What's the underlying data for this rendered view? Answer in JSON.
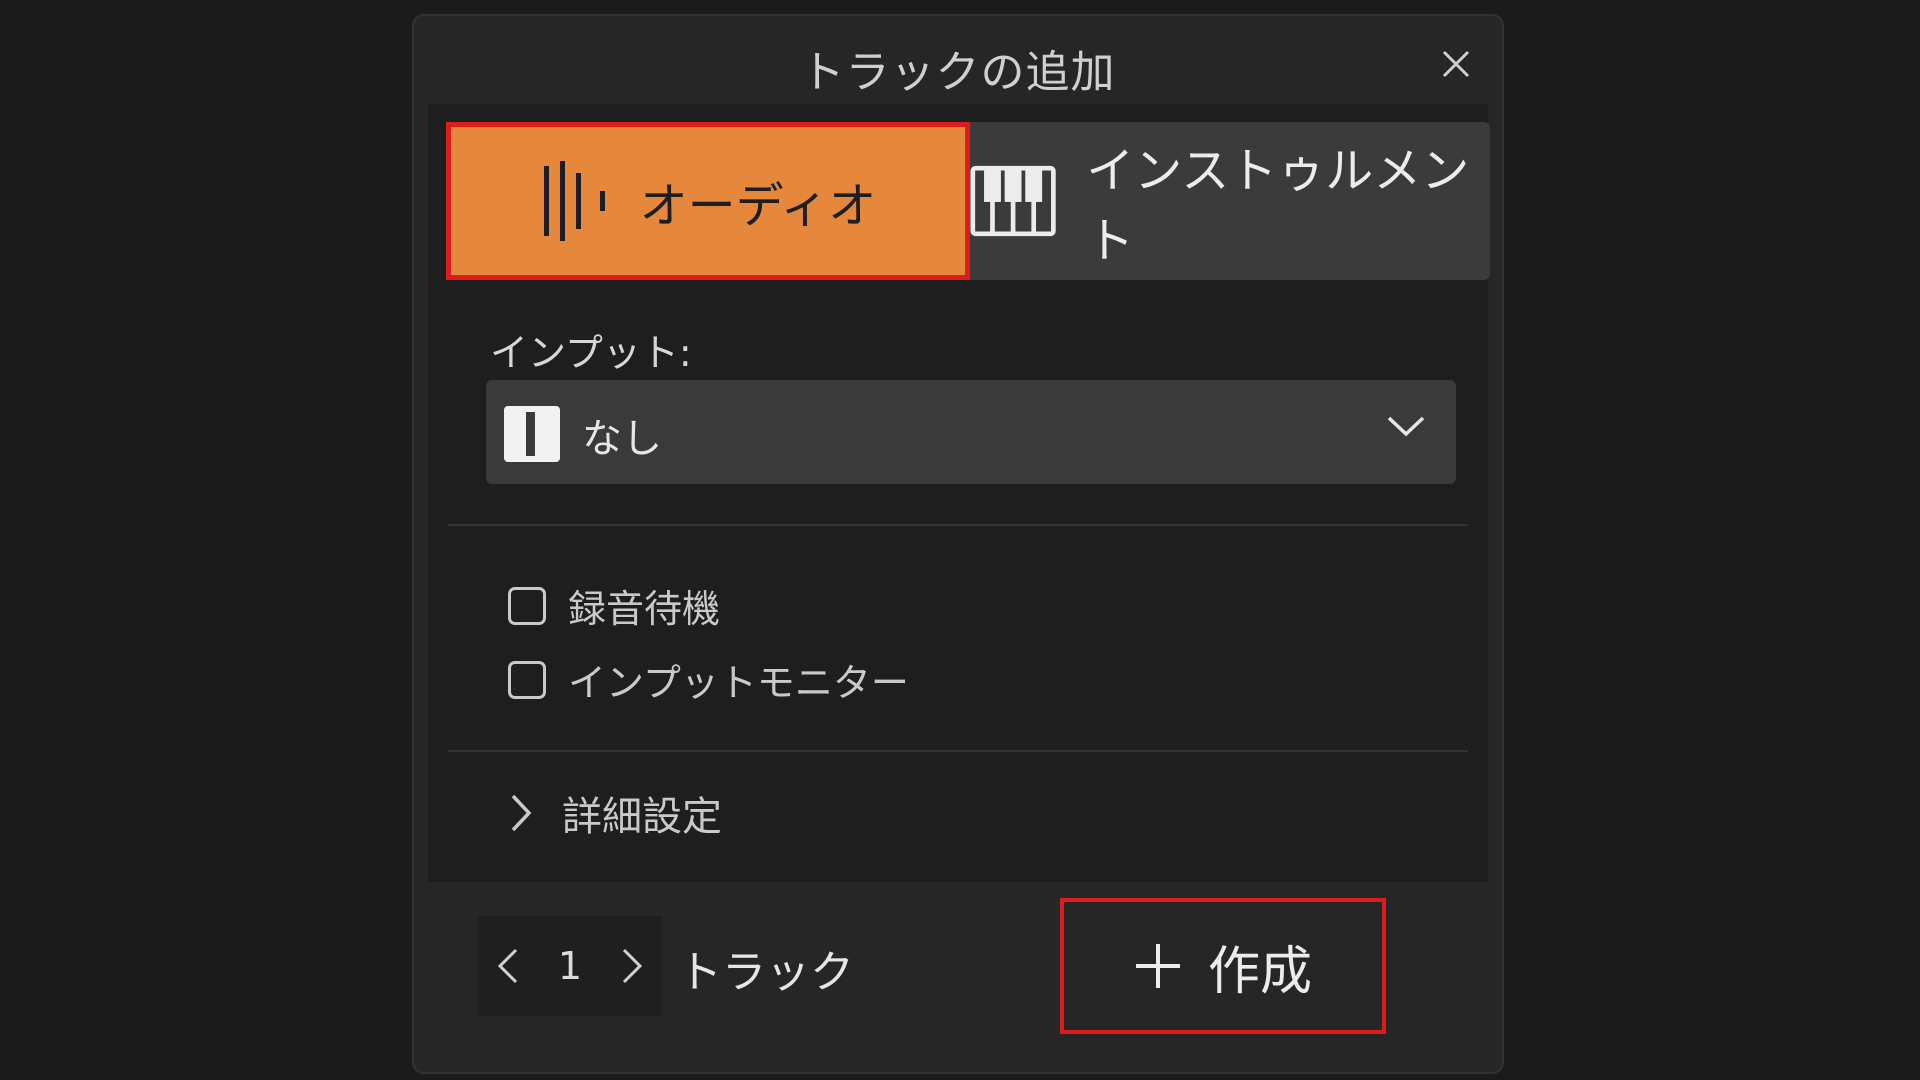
{
  "dialog": {
    "title": "トラックの追加",
    "close_icon": "close-icon"
  },
  "track_type": {
    "audio_label": "オーディオ",
    "audio_icon": "waveform-icon",
    "instrument_label": "インストゥルメント",
    "instrument_icon": "piano-keys-icon",
    "selected": "audio"
  },
  "input": {
    "label": "インプット:",
    "value": "なし",
    "icon": "mono-input-icon"
  },
  "options": {
    "record_arm": "録音待機",
    "input_monitor": "インプットモニター"
  },
  "advanced": {
    "label": "詳細設定"
  },
  "footer": {
    "track_count": "1",
    "track_label": "トラック",
    "create_label": "作成"
  },
  "colors": {
    "accent": "#e5883c",
    "highlight": "#e01b1b",
    "background": "#262626"
  }
}
